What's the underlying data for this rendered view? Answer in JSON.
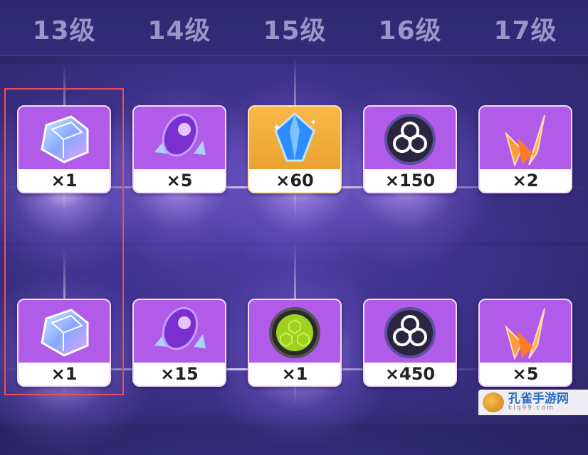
{
  "levels": [
    "13级",
    "14级",
    "15级",
    "16级",
    "17级"
  ],
  "rows": [
    [
      {
        "icon": "prism-cube-icon",
        "qty": "×1",
        "bg": "#b15ce8"
      },
      {
        "icon": "purple-orb-crystal-icon",
        "qty": "×5",
        "bg": "#b15ce8"
      },
      {
        "icon": "blue-crystal-icon",
        "qty": "×60",
        "bg": "#f2b03e"
      },
      {
        "icon": "triskelion-coin-icon",
        "qty": "×150",
        "bg": "#b15ce8"
      },
      {
        "icon": "flame-shard-icon",
        "qty": "×2",
        "bg": "#b15ce8"
      }
    ],
    [
      {
        "icon": "prism-cube-icon",
        "qty": "×1",
        "bg": "#b15ce8"
      },
      {
        "icon": "purple-orb-crystal-icon",
        "qty": "×15",
        "bg": "#b15ce8"
      },
      {
        "icon": "green-honeycomb-orb-icon",
        "qty": "×1",
        "bg": "#b15ce8"
      },
      {
        "icon": "triskelion-coin-icon",
        "qty": "×450",
        "bg": "#b15ce8"
      },
      {
        "icon": "flame-shard-icon",
        "qty": "×5",
        "bg": "#b15ce8"
      }
    ]
  ],
  "watermark": {
    "main": "孔雀手游网",
    "sub": "klq99.com"
  }
}
